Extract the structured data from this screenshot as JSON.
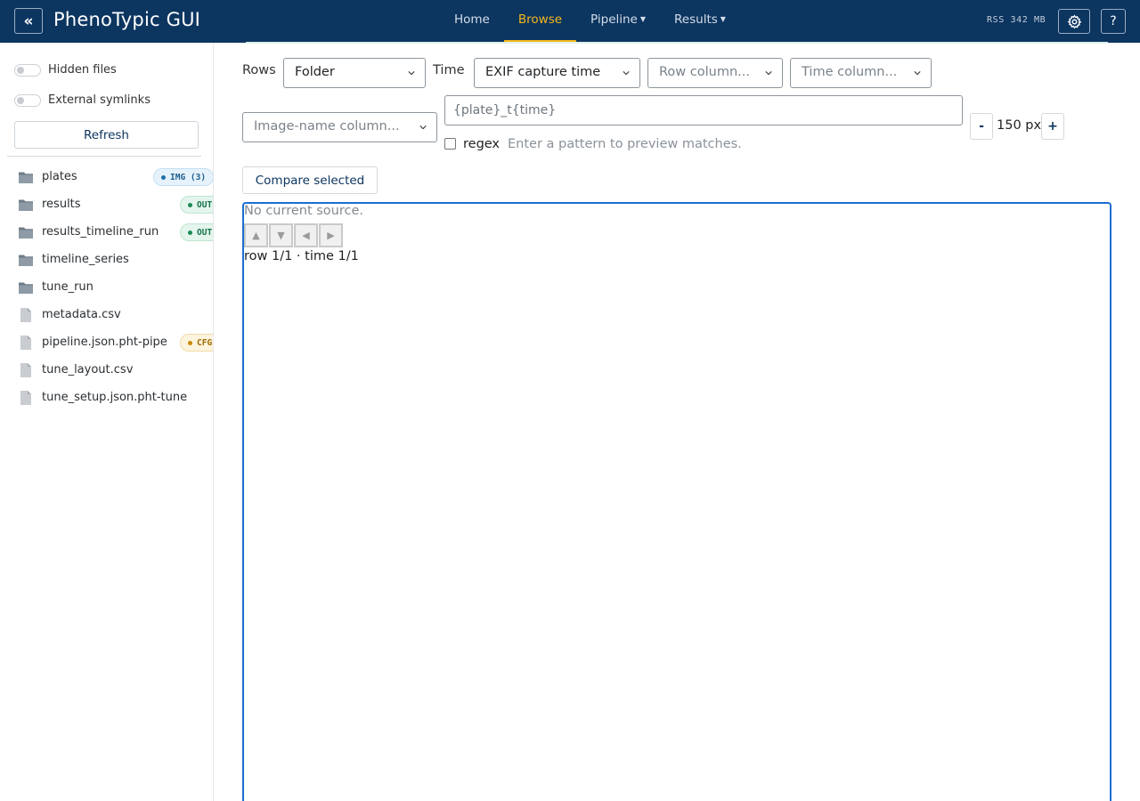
{
  "header": {
    "collapse_glyph": "«",
    "title": "PhenoTypic GUI",
    "nav": [
      {
        "label": "Home",
        "dropdown": false
      },
      {
        "label": "Browse",
        "dropdown": false,
        "active": true
      },
      {
        "label": "Pipeline",
        "dropdown": true
      },
      {
        "label": "Results",
        "dropdown": true
      }
    ],
    "rss": "RSS 342 MB",
    "help_label": "?"
  },
  "sidebar": {
    "hidden_files_label": "Hidden files",
    "external_symlinks_label": "External symlinks",
    "refresh_label": "Refresh",
    "items": [
      {
        "name": "plates",
        "type": "folder",
        "badge": "IMG (3)",
        "badge_kind": "img"
      },
      {
        "name": "results",
        "type": "folder",
        "badge": "OUT",
        "badge_kind": "out"
      },
      {
        "name": "results_timeline_run",
        "type": "folder",
        "badge": "OUT",
        "badge_kind": "out"
      },
      {
        "name": "timeline_series",
        "type": "folder"
      },
      {
        "name": "tune_run",
        "type": "folder"
      },
      {
        "name": "metadata.csv",
        "type": "file"
      },
      {
        "name": "pipeline.json.pht-pipe",
        "type": "file",
        "badge": "CFG",
        "badge_kind": "cfg"
      },
      {
        "name": "tune_layout.csv",
        "type": "file"
      },
      {
        "name": "tune_setup.json.pht-tune",
        "type": "file"
      }
    ]
  },
  "controls": {
    "rows_label": "Rows",
    "rows_value": "Folder",
    "time_label": "Time",
    "time_value": "EXIF capture time",
    "row_column_placeholder": "Row column...",
    "time_column_placeholder": "Time column...",
    "image_name_column_placeholder": "Image-name column...",
    "pattern_value": "{plate}_t{time}",
    "regex_label": "regex",
    "regex_hint": "Enter a pattern to preview matches.",
    "minus_label": "-",
    "plus_label": "+",
    "size_value": "150 px",
    "compare_label": "Compare selected"
  },
  "viewer": {
    "status": "No current source.",
    "arrows": [
      "▲",
      "▼",
      "◀",
      "▶"
    ],
    "position": "row 1/1 · time 1/1"
  },
  "colors": {
    "header_bg": "#0c3560",
    "accent_active": "#f3b81b",
    "viewer_border": "#1a6fd0"
  }
}
